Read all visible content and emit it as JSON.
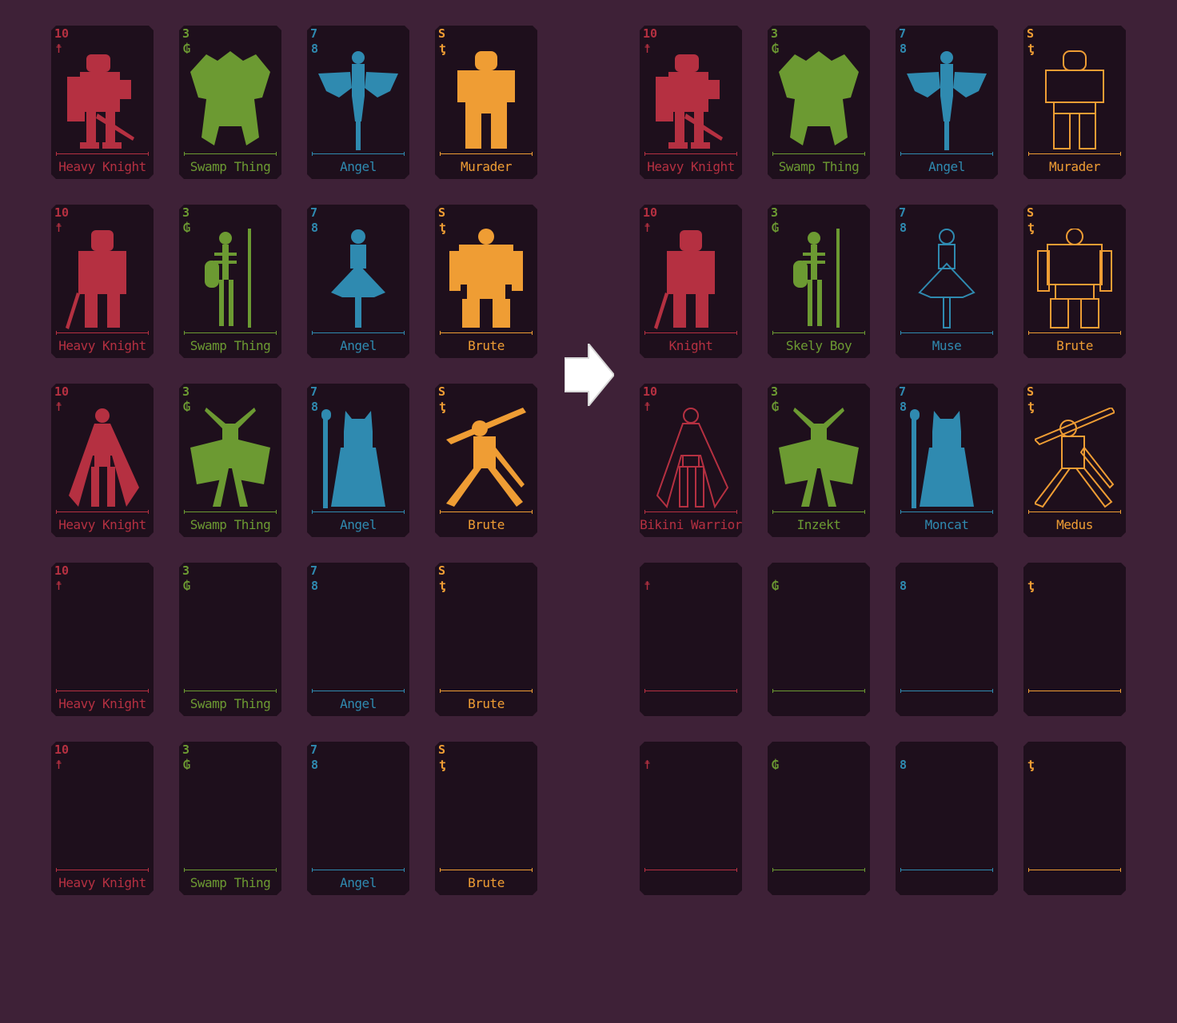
{
  "colors": {
    "background": "#3e2137",
    "card": "#1e0f1c",
    "red": "#b53041",
    "green": "#6c9a32",
    "blue": "#2f8ab0",
    "orange": "#ef9d34",
    "arrow": "#ffffff"
  },
  "suits": {
    "red": {
      "rank": "10",
      "glyph": "☨",
      "color": "#b53041"
    },
    "green": {
      "rank": "3",
      "glyph": "₲",
      "color": "#6c9a32"
    },
    "blue": {
      "rank": "7",
      "glyph": "8",
      "color": "#2f8ab0"
    },
    "orange": {
      "rank": "S",
      "glyph": "ƫ",
      "color": "#ef9d34"
    }
  },
  "arrow_icon": "right-arrow-icon",
  "grids": {
    "left": {
      "rows": [
        [
          {
            "suit": "red",
            "name": "Heavy Knight",
            "art": "knight-shield"
          },
          {
            "suit": "green",
            "name": "Swamp Thing",
            "art": "beast"
          },
          {
            "suit": "blue",
            "name": "Angel",
            "art": "angel"
          },
          {
            "suit": "orange",
            "name": "Murader",
            "art": "brute-arms"
          }
        ],
        [
          {
            "suit": "red",
            "name": "Heavy Knight",
            "art": "knight"
          },
          {
            "suit": "green",
            "name": "Swamp Thing",
            "art": "skeleton"
          },
          {
            "suit": "blue",
            "name": "Angel",
            "art": "dancer"
          },
          {
            "suit": "orange",
            "name": "Brute",
            "art": "muscle"
          }
        ],
        [
          {
            "suit": "red",
            "name": "Heavy Knight",
            "art": "warrior-cape"
          },
          {
            "suit": "green",
            "name": "Swamp Thing",
            "art": "insect"
          },
          {
            "suit": "blue",
            "name": "Angel",
            "art": "cat-mage"
          },
          {
            "suit": "orange",
            "name": "Brute",
            "art": "swords"
          }
        ],
        [
          {
            "suit": "red",
            "name": "Heavy Knight",
            "art": ""
          },
          {
            "suit": "green",
            "name": "Swamp Thing",
            "art": ""
          },
          {
            "suit": "blue",
            "name": "Angel",
            "art": ""
          },
          {
            "suit": "orange",
            "name": "Brute",
            "art": ""
          }
        ],
        [
          {
            "suit": "red",
            "name": "Heavy Knight",
            "art": ""
          },
          {
            "suit": "green",
            "name": "Swamp Thing",
            "art": ""
          },
          {
            "suit": "blue",
            "name": "Angel",
            "art": ""
          },
          {
            "suit": "orange",
            "name": "Brute",
            "art": ""
          }
        ]
      ]
    },
    "right": {
      "rows": [
        [
          {
            "suit": "red",
            "name": "Heavy Knight",
            "art": "knight-shield"
          },
          {
            "suit": "green",
            "name": "Swamp Thing",
            "art": "beast"
          },
          {
            "suit": "blue",
            "name": "Angel",
            "art": "angel"
          },
          {
            "suit": "orange",
            "name": "Murader",
            "art": "brute-arms",
            "outline": true
          }
        ],
        [
          {
            "suit": "red",
            "name": "Knight",
            "art": "knight"
          },
          {
            "suit": "green",
            "name": "Skely Boy",
            "art": "skeleton"
          },
          {
            "suit": "blue",
            "name": "Muse",
            "art": "dancer",
            "outline": true
          },
          {
            "suit": "orange",
            "name": "Brute",
            "art": "muscle",
            "outline": true
          }
        ],
        [
          {
            "suit": "red",
            "name": "Bikini Warrior",
            "art": "warrior-cape",
            "outline": true
          },
          {
            "suit": "green",
            "name": "Inzekt",
            "art": "insect"
          },
          {
            "suit": "blue",
            "name": "Moncat",
            "art": "cat-mage"
          },
          {
            "suit": "orange",
            "name": "Medus",
            "art": "swords",
            "outline": true
          }
        ],
        [
          {
            "suit": "red",
            "name": "",
            "art": "",
            "hide_rank": true
          },
          {
            "suit": "green",
            "name": "",
            "art": "",
            "hide_rank": true
          },
          {
            "suit": "blue",
            "name": "",
            "art": "",
            "hide_rank": true
          },
          {
            "suit": "orange",
            "name": "",
            "art": "",
            "hide_rank": true
          }
        ],
        [
          {
            "suit": "red",
            "name": "",
            "art": "",
            "hide_rank": true
          },
          {
            "suit": "green",
            "name": "",
            "art": "",
            "hide_rank": true
          },
          {
            "suit": "blue",
            "name": "",
            "art": "",
            "hide_rank": true
          },
          {
            "suit": "orange",
            "name": "",
            "art": "",
            "hide_rank": true
          }
        ]
      ]
    }
  }
}
